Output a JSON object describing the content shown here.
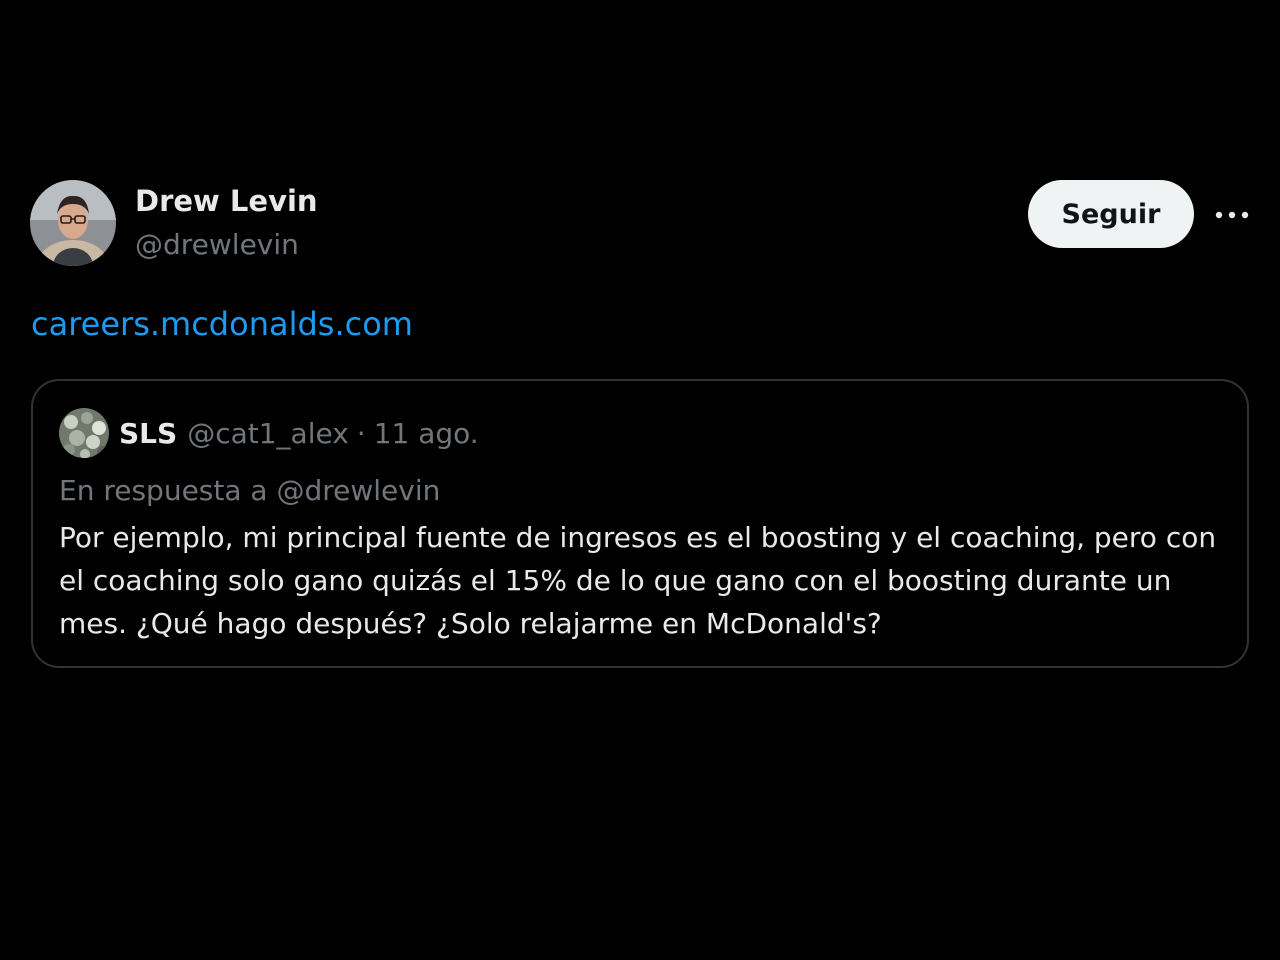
{
  "tweet": {
    "author": {
      "name": "Drew Levin",
      "handle": "@drewlevin"
    },
    "follow_label": "Seguir",
    "more_icon": "more-horizontal-icon",
    "link_text": "careers.mcdonalds.com"
  },
  "quoted_tweet": {
    "author_name": "SLS",
    "author_handle": "@cat1_alex",
    "separator": "·",
    "date": "11 ago.",
    "reply_prefix": "En respuesta a",
    "reply_handle": "@drewlevin",
    "text": "Por ejemplo, mi principal fuente de ingresos es el boosting y el coaching, pero con el coaching solo gano quizás el 15% de lo que gano con el boosting durante un mes. ¿Qué hago después? ¿Solo relajarme en McDonald's?"
  },
  "colors": {
    "background": "#000000",
    "text_primary": "#e7e9ea",
    "text_secondary": "#71767b",
    "link": "#1d9bf0",
    "border": "#2f3336",
    "button_bg": "#eff3f4"
  }
}
